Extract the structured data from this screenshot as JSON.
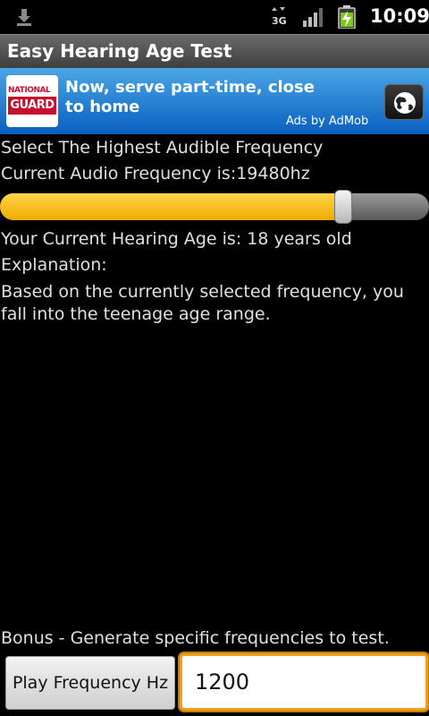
{
  "status_bar": {
    "time": "10:09",
    "network": "3G",
    "icons": [
      "download-icon",
      "3g-icon",
      "signal-icon",
      "battery-charging-icon"
    ]
  },
  "app": {
    "title": "Easy Hearing Age Test"
  },
  "ad": {
    "logo_line1": "NATIONAL",
    "logo_line2": "GUARD",
    "text": "Now, serve part-time, close to home",
    "attribution": "Ads by AdMob",
    "icon": "globe-icon",
    "colors": {
      "top": "#4aa6e6",
      "bottom": "#0a5fbf"
    }
  },
  "main": {
    "prompt": "Select The Highest Audible Frequency",
    "current_frequency": "Current Audio Frequency is:19480hz",
    "slider": {
      "value_fraction": 0.8,
      "accent_color": "#f2a900"
    },
    "hearing_age": "Your Current Hearing Age is: 18 years old",
    "explanation_label": "Explanation:",
    "explanation_text": "Based on the currently selected frequency, you fall into the teenage age range."
  },
  "bonus": {
    "label": "Bonus - Generate specific frequencies to test.",
    "play_button": "Play Frequency Hz",
    "frequency_value": "1200"
  }
}
